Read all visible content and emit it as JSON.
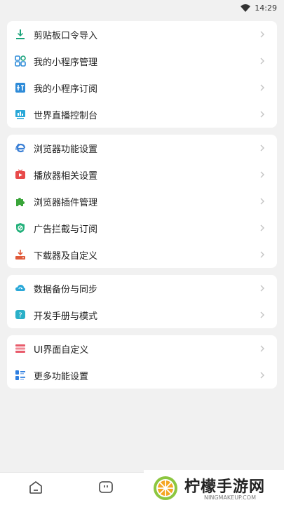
{
  "status": {
    "time": "14:29"
  },
  "groups": [
    {
      "items": [
        {
          "label": "剪贴板口令导入",
          "icon": "clipboard-import-icon",
          "color": "#1aa37a"
        },
        {
          "label": "我的小程序管理",
          "icon": "miniprogram-manage-icon",
          "color": "#2e8bd8"
        },
        {
          "label": "我的小程序订阅",
          "icon": "miniprogram-subscribe-icon",
          "color": "#2e8bd8"
        },
        {
          "label": "世界直播控制台",
          "icon": "live-console-icon",
          "color": "#2aa8d8"
        }
      ]
    },
    {
      "items": [
        {
          "label": "浏览器功能设置",
          "icon": "browser-settings-icon",
          "color": "#3a7fd5"
        },
        {
          "label": "播放器相关设置",
          "icon": "player-settings-icon",
          "color": "#e84a4a"
        },
        {
          "label": "浏览器插件管理",
          "icon": "plugin-manage-icon",
          "color": "#3aa53a"
        },
        {
          "label": "广告拦截与订阅",
          "icon": "adblock-icon",
          "color": "#22b07a"
        },
        {
          "label": "下载器及自定义",
          "icon": "downloader-icon",
          "color": "#e05a3a"
        }
      ]
    },
    {
      "items": [
        {
          "label": "数据备份与同步",
          "icon": "backup-sync-icon",
          "color": "#2aa8d8"
        },
        {
          "label": "开发手册与模式",
          "icon": "dev-manual-icon",
          "color": "#2ab0c8"
        }
      ]
    },
    {
      "items": [
        {
          "label": "UI界面自定义",
          "icon": "ui-custom-icon",
          "color": "#e85a6a"
        },
        {
          "label": "更多功能设置",
          "icon": "more-settings-icon",
          "color": "#2e7fe0"
        }
      ]
    }
  ],
  "tabbar": {
    "tabs": [
      {
        "icon": "home-icon"
      },
      {
        "icon": "message-icon"
      }
    ]
  },
  "watermark": {
    "brand": "柠檬手游网",
    "site": "NINGMAKEUP.COM"
  }
}
